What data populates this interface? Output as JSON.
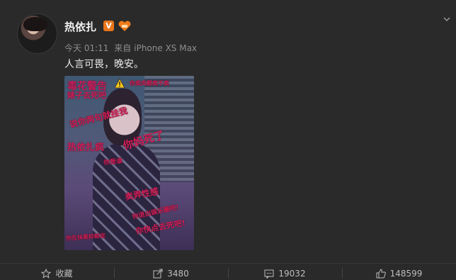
{
  "post": {
    "author": "热依扎",
    "verified_badge": "V",
    "time": "今天 01:11",
    "source_prefix": "来自",
    "source": "iPhone XS Max",
    "text": "人言可畏，晚安。"
  },
  "image_graffiti": [
    "毒花警告",
    "你卖肉都卖不卖",
    "婊子去死吧",
    "说你两句就挂我",
    "热依扎疯",
    "你妈死了",
    "你是谁",
    "卖弄性感",
    "你退出娱乐圈吧!",
    "你快点去死吧!",
    "你在抹黑抑郁症"
  ],
  "actions": {
    "favorite_label": "收藏",
    "share_count": "3480",
    "comment_count": "19032",
    "like_count": "148599"
  },
  "colors": {
    "background": "#2a2a2a",
    "graffiti": "#d4205a",
    "verified": "#e8761a"
  },
  "icons": [
    "chevron-down-icon",
    "warning-icon",
    "star-icon",
    "share-icon",
    "comment-icon",
    "like-icon"
  ]
}
